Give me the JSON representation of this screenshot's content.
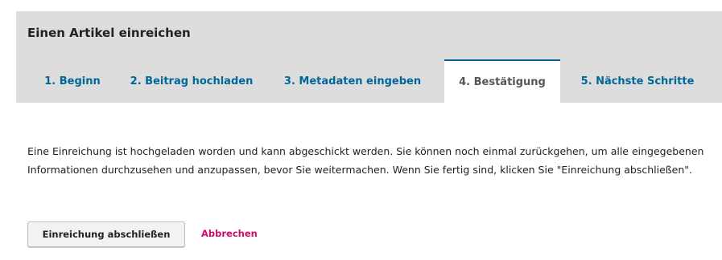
{
  "panel": {
    "title": "Einen Artikel einreichen"
  },
  "tabs": [
    {
      "label": "1. Beginn",
      "active": false
    },
    {
      "label": "2. Beitrag hochladen",
      "active": false
    },
    {
      "label": "3. Metadaten eingeben",
      "active": false
    },
    {
      "label": "4. Bestätigung",
      "active": true
    },
    {
      "label": "5. Nächste Schritte",
      "active": false
    }
  ],
  "confirmation": {
    "text": "Eine Einreichung ist hochgeladen worden und kann abgeschickt werden. Sie können noch einmal zurückgehen, um alle eingegebenen Informationen durchzusehen und anzupassen, bevor Sie weitermachen. Wenn Sie fertig sind, klicken Sie \"Einreichung abschließen\"."
  },
  "actions": {
    "submit_label": "Einreichung abschließen",
    "cancel_label": "Abbrechen"
  },
  "colors": {
    "tab_link": "#006798",
    "cancel_link": "#d00a6c",
    "header_background": "#dddddd"
  }
}
